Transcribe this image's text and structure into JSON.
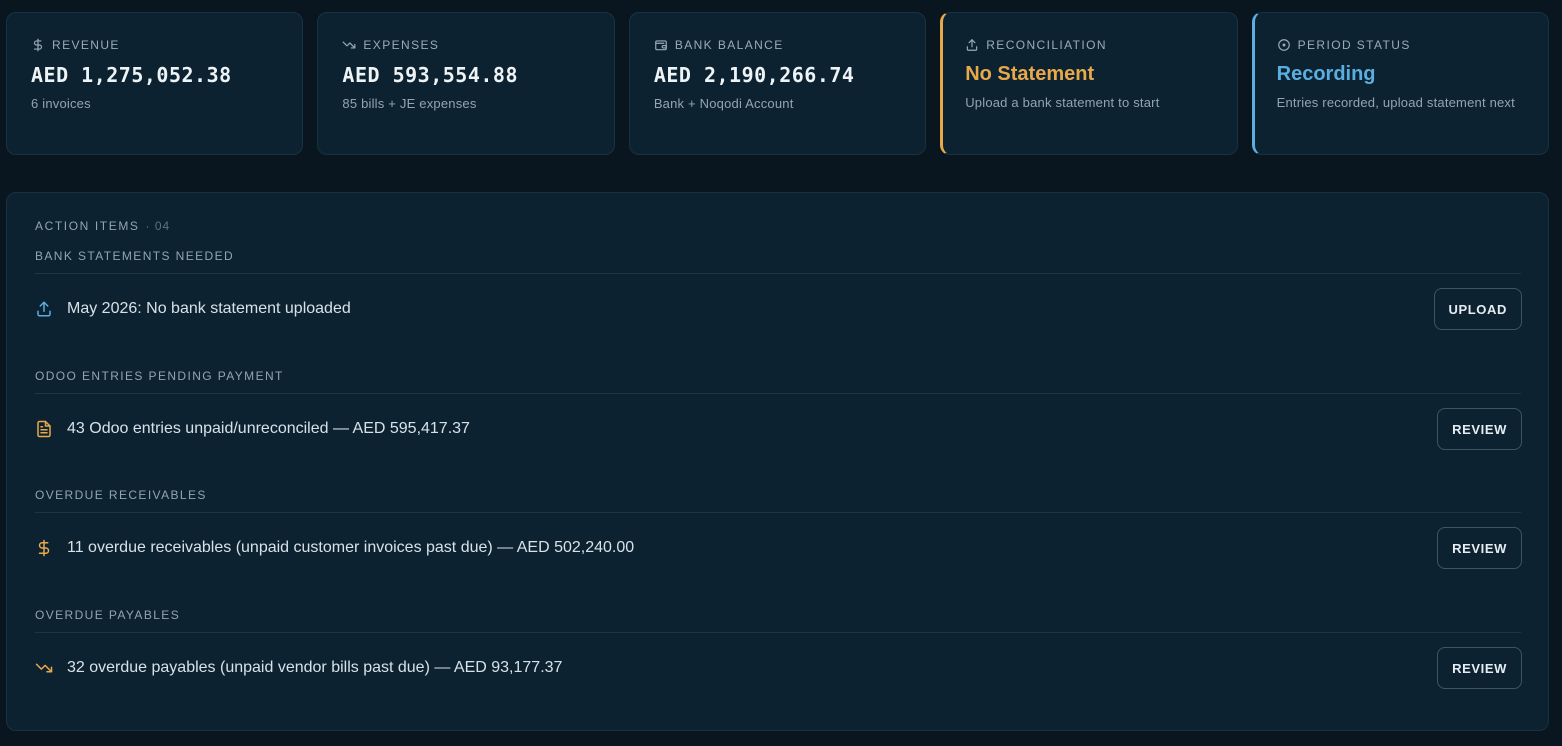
{
  "colors": {
    "background": "#09161f",
    "card": "#0d2230",
    "amber": "#e8a94a",
    "blue": "#5aaee0",
    "muted": "#93a4b1"
  },
  "kpis": [
    {
      "icon": "dollar-icon",
      "label": "REVENUE",
      "value": "AED 1,275,052.38",
      "sub": "6 invoices"
    },
    {
      "icon": "trending-down-icon",
      "label": "EXPENSES",
      "value": "AED 593,554.88",
      "sub": "85 bills + JE expenses"
    },
    {
      "icon": "wallet-icon",
      "label": "BANK BALANCE",
      "value": "AED 2,190,266.74",
      "sub": "Bank + Noqodi Account"
    },
    {
      "icon": "upload-icon",
      "label": "RECONCILIATION",
      "value": "No Statement",
      "sub": "Upload a bank statement to start"
    },
    {
      "icon": "clock-icon",
      "label": "PERIOD STATUS",
      "value": "Recording",
      "sub": "Entries recorded, upload statement next"
    }
  ],
  "action_items": {
    "title": "ACTION ITEMS",
    "count": "· 04",
    "sections": [
      {
        "label": "BANK STATEMENTS NEEDED",
        "icon": "upload-icon",
        "text": "May 2026: No bank statement uploaded",
        "button": "UPLOAD"
      },
      {
        "label": "ODOO ENTRIES PENDING PAYMENT",
        "icon": "document-icon",
        "text": "43 Odoo entries unpaid/unreconciled — AED 595,417.37",
        "button": "REVIEW"
      },
      {
        "label": "OVERDUE RECEIVABLES",
        "icon": "dollar-icon",
        "text": "11 overdue receivables (unpaid customer invoices past due) — AED 502,240.00",
        "button": "REVIEW"
      },
      {
        "label": "OVERDUE PAYABLES",
        "icon": "trending-down-icon",
        "text": "32 overdue payables (unpaid vendor bills past due) — AED 93,177.37",
        "button": "REVIEW"
      }
    ]
  }
}
